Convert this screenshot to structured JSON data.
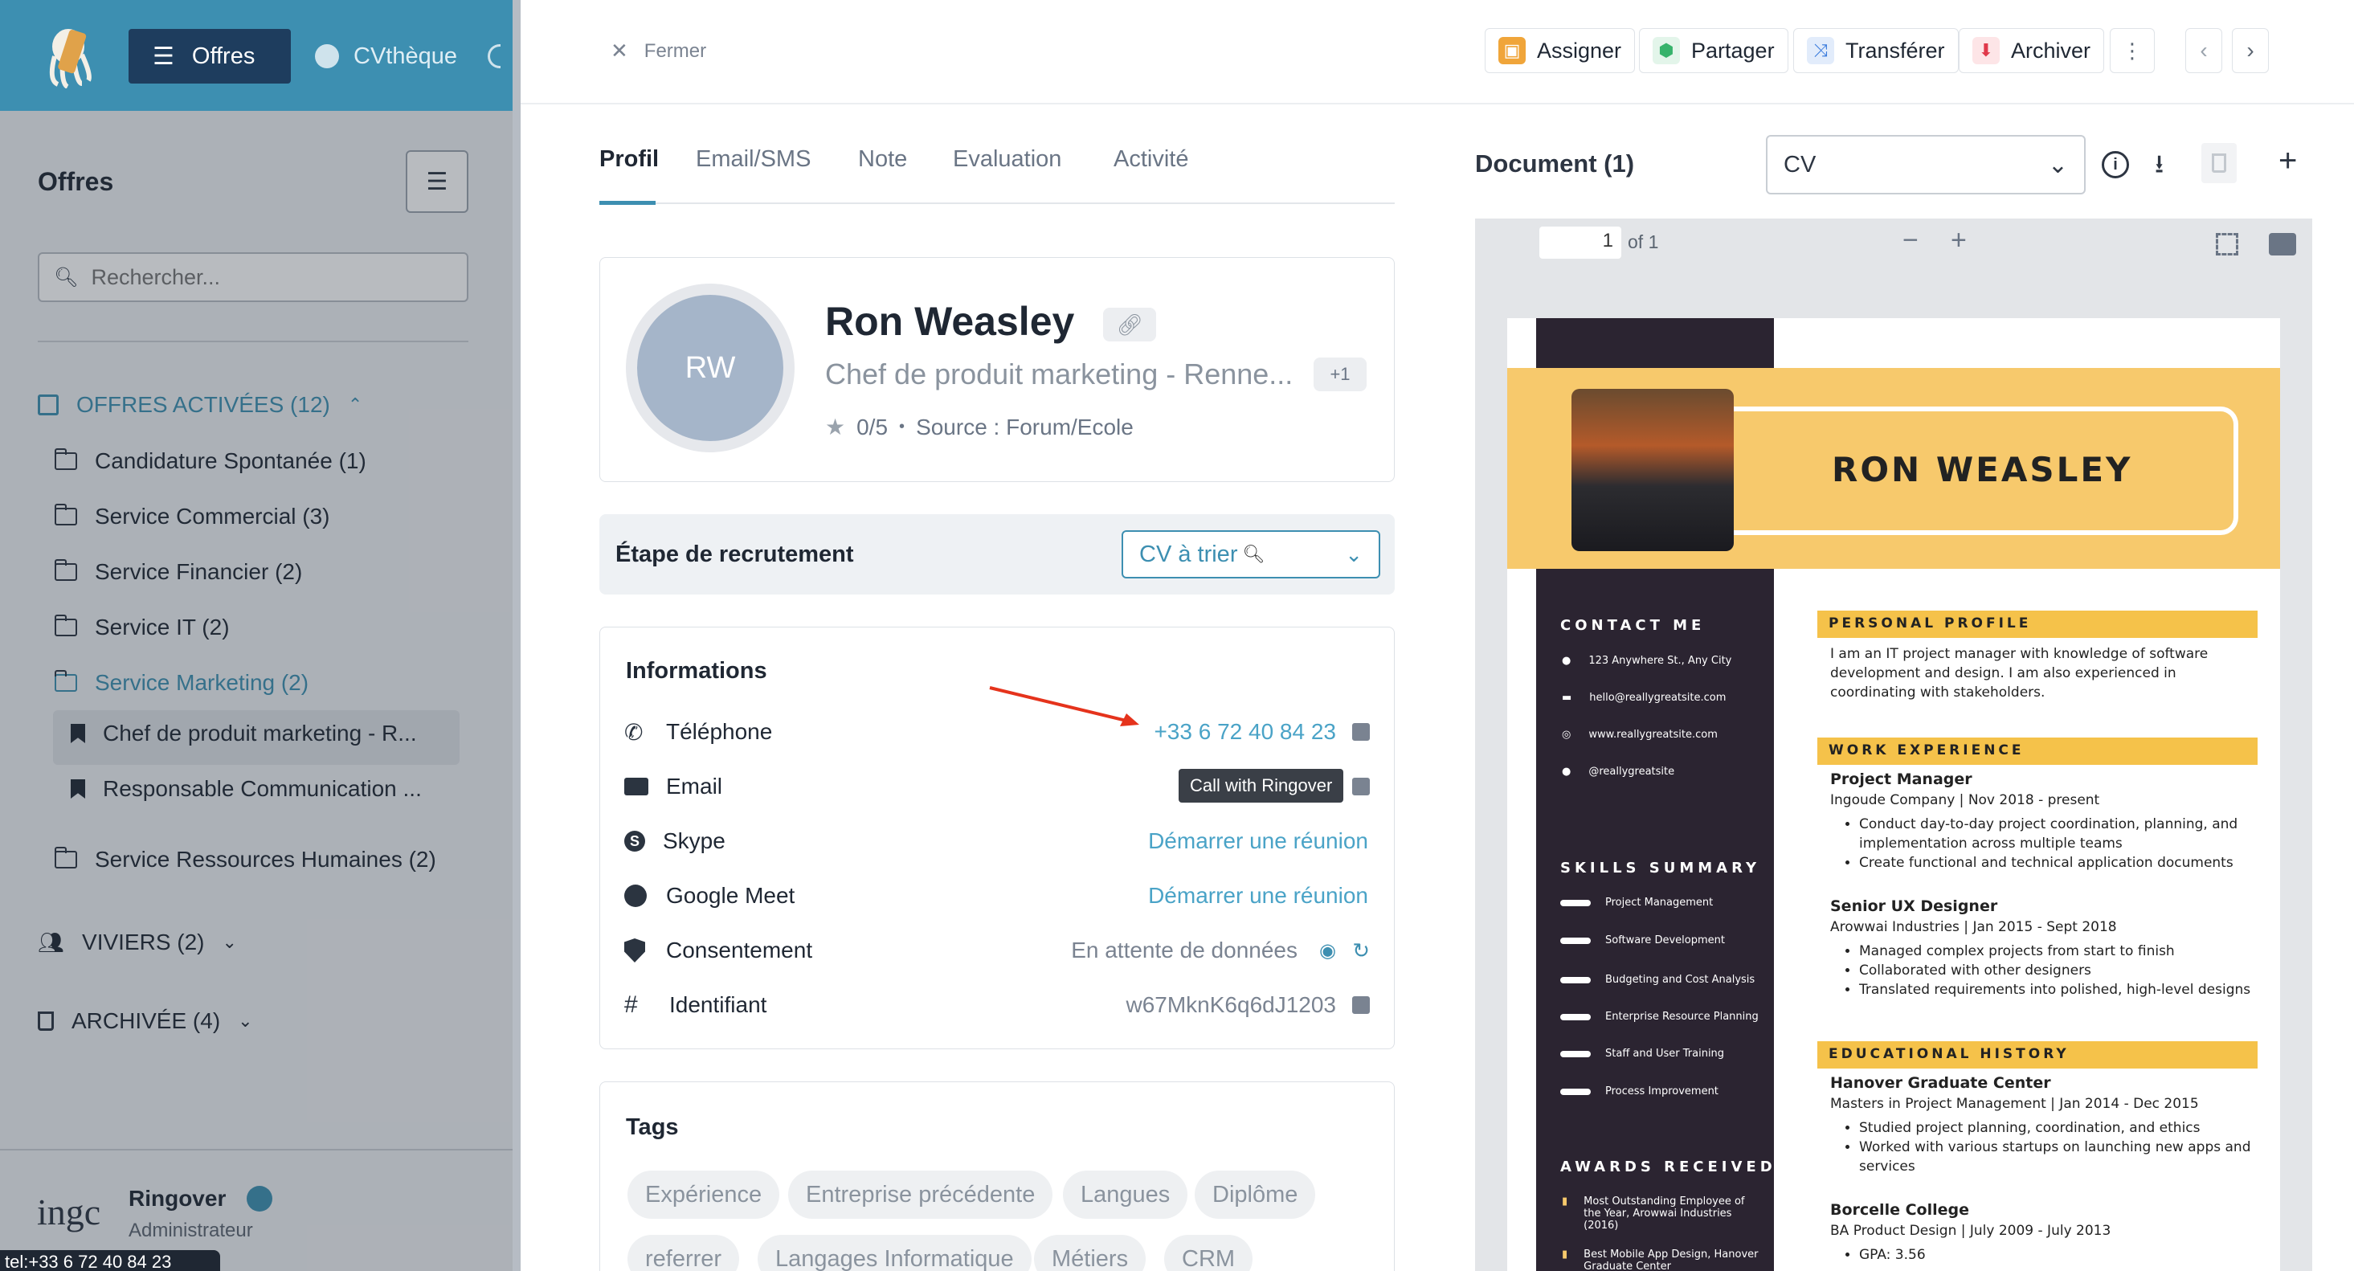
{
  "topnav": {
    "offres": "Offres",
    "cvtheque": "CVthèque"
  },
  "sidebar": {
    "title": "Offres",
    "search_placeholder": "Rechercher...",
    "active_offers": "OFFRES ACTIVÉES (12)",
    "items": [
      "Candidature Spontanée (1)",
      "Service Commercial (3)",
      "Service Financier (2)",
      "Service IT (2)",
      "Service Marketing (2)",
      "Chef de produit marketing - R...",
      "Responsable Communication ...",
      "Service Ressources Humaines (2)"
    ],
    "viviers": "VIVIERS (2)",
    "archivee": "ARCHIVÉE (4)",
    "user_name": "Ringover",
    "user_role": "Administrateur",
    "logo_text": "ingc",
    "status_url": "tel:+33 6 72 40 84 23"
  },
  "header": {
    "close": "Fermer",
    "assign": "Assigner",
    "share": "Partager",
    "transfer": "Transférer",
    "archive": "Archiver"
  },
  "tabs": [
    "Profil",
    "Email/SMS",
    "Note",
    "Evaluation",
    "Activité"
  ],
  "profile": {
    "initials": "RW",
    "name": "Ron Weasley",
    "title": "Chef de produit marketing - Renne...",
    "plus": "+1",
    "rating": "0/5",
    "source": "Source : Forum/Ecole"
  },
  "stage": {
    "label": "Étape de recrutement",
    "value": "CV à trier"
  },
  "info": {
    "title": "Informations",
    "rows": [
      {
        "label": "Téléphone",
        "value": "+33 6 72 40 84 23"
      },
      {
        "label": "Email",
        "value": ""
      },
      {
        "label": "Skype",
        "value": "Démarrer une réunion"
      },
      {
        "label": "Google Meet",
        "value": "Démarrer une réunion"
      },
      {
        "label": "Consentement",
        "value": "En attente de données"
      },
      {
        "label": "Identifiant",
        "value": "w67MknK6q6dJ1203"
      }
    ],
    "tooltip": "Call with Ringover"
  },
  "tags": {
    "title": "Tags",
    "items": [
      "Expérience",
      "Entreprise précédente",
      "Langues",
      "Diplôme",
      "referrer",
      "Langages Informatique",
      "Métiers",
      "CRM"
    ]
  },
  "document": {
    "title": "Document (1)",
    "select": "CV",
    "page": "1",
    "of": "of 1"
  },
  "cv": {
    "name": "RON WEASLEY",
    "contact_title": "CONTACT ME",
    "contact": [
      "123 Anywhere St., Any City",
      "hello@reallygreatsite.com",
      "www.reallygreatsite.com",
      "@reallygreatsite"
    ],
    "skills_title": "SKILLS SUMMARY",
    "skills": [
      "Project Management",
      "Software Development",
      "Budgeting and Cost Analysis",
      "Enterprise Resource Planning",
      "Staff and User Training",
      "Process Improvement"
    ],
    "awards_title": "AWARDS RECEIVED",
    "award1": "Most Outstanding Employee of the Year, Arowwai Industries (2016)",
    "award2": "Best Mobile App Design, Hanover Graduate Center",
    "profile_title": "PERSONAL PROFILE",
    "profile_text": "I am an IT project manager with knowledge of software development and design. I am also experienced in coordinating with stakeholders.",
    "work_title": "WORK EXPERIENCE",
    "job1_title": "Project Manager",
    "job1_sub": "Ingoude Company  | Nov 2018 - present",
    "job1_b": [
      "Conduct day-to-day project coordination, planning, and implementation across multiple teams",
      "Create functional and technical application documents"
    ],
    "job2_title": "Senior UX Designer",
    "job2_sub": "Arowwai Industries | Jan 2015 - Sept 2018",
    "job2_b": [
      "Managed complex projects from start to finish",
      "Collaborated with other designers",
      "Translated requirements into polished, high-level designs"
    ],
    "edu_title": "EDUCATIONAL HISTORY",
    "edu1_title": "Hanover Graduate Center",
    "edu1_sub": "Masters in Project Management | Jan 2014 - Dec 2015",
    "edu1_b": [
      "Studied project planning, coordination, and ethics",
      "Worked with various startups on launching new apps and services"
    ],
    "edu2_title": "Borcelle College",
    "edu2_sub": "BA Product Design | July 2009 - July 2013",
    "edu2_b": [
      "GPA: 3.56"
    ]
  }
}
